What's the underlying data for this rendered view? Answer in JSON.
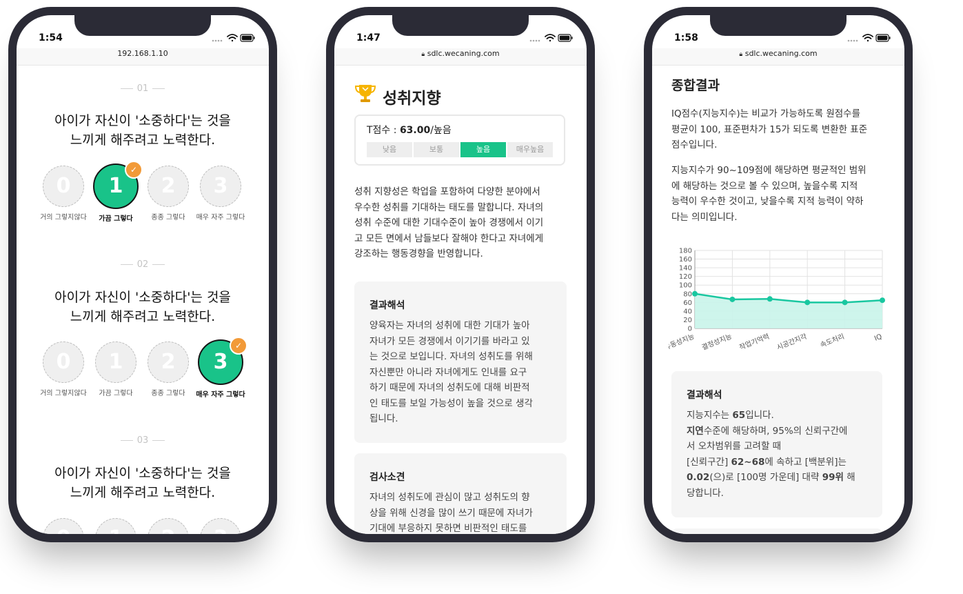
{
  "phones": [
    {
      "status": {
        "time": "1:54"
      },
      "url": "192.168.1.10",
      "questions": [
        {
          "number": "01",
          "text_line1": "아이가 자신이 '소중하다'는 것을",
          "text_line2": "느끼게 해주려고 노력한다.",
          "selected": 1
        },
        {
          "number": "02",
          "text_line1": "아이가 자신이 '소중하다'는 것을",
          "text_line2": "느끼게 해주려고 노력한다.",
          "selected": 3
        },
        {
          "number": "03",
          "text_line1": "아이가 자신이 '소중하다'는 것을",
          "text_line2": "느끼게 해주려고 노력한다.",
          "selected": null
        }
      ],
      "options": [
        {
          "value": "0",
          "label": "거의 그렇지않다"
        },
        {
          "value": "1",
          "label": "가끔 그렇다"
        },
        {
          "value": "2",
          "label": "종종 그렇다"
        },
        {
          "value": "3",
          "label": "매우 자주 그렇다"
        }
      ]
    },
    {
      "status": {
        "time": "1:47"
      },
      "url": "sdlc.wecaning.com",
      "title": "성취지향",
      "t_score_label": "T점수 : ",
      "t_score_value": "63.00",
      "t_score_level": "/높음",
      "levels": [
        "낮음",
        "보통",
        "높음",
        "매우높음"
      ],
      "active_level": "높음",
      "description": [
        "성취 지향성은 학업을 포함하여 다양한 분야에서",
        "우수한 성취를 기대하는 태도를 말합니다. 자녀의",
        "성취 수준에 대한 기대수준이 높아 경쟁에서 이기",
        "고 모든 면에서 남들보다 잘해야 한다고 자녀에게",
        "강조하는 행동경향을 반영합니다."
      ],
      "result": {
        "heading": "결과해석",
        "lines": [
          "양육자는 자녀의 성취에 대한 기대가 높아",
          "자녀가 모든 경쟁에서 이기기를 바라고 있",
          "는 것으로 보입니다. 자녀의 성취도를 위해",
          "자신뿐만 아니라 자녀에게도 인내를 요구",
          "하기 때문에 자녀의 성취도에 대해 비판적",
          "인 태도를 보일 가능성이 높을 것으로 생각",
          "됩니다."
        ]
      },
      "opinion": {
        "heading": "검사소견",
        "lines": [
          "자녀의 성취도에 관심이 많고 성취도의 향",
          "상을 위해 신경을 많이 쓰기 때문에 자녀가",
          "기대에 부응하지 못하면 비판적인 태도를"
        ]
      }
    },
    {
      "status": {
        "time": "1:58"
      },
      "url": "sdlc.wecaning.com",
      "title": "종합결과",
      "para1": [
        "IQ점수(지능지수)는 비교가 가능하도록 원점수를",
        "평균이 100, 표준편차가 15가 되도록 변환한 표준",
        "점수입니다."
      ],
      "para2": [
        "지능지수가 90~109점에 해당하면 평균적인 범위",
        "에 해당하는 것으로 볼 수 있으며, 높을수록 지적",
        "능력이 우수한 것이고, 낮을수록 지적 능력이 약하",
        "다는 의미입니다."
      ],
      "result": {
        "heading": "결과해석",
        "iq_prefix": "지능지수는 ",
        "iq_value": "65",
        "iq_suffix": "입니다.",
        "level_word": "지연",
        "level_rest": "수준에 해당하며, 95%의 신뢰구간에",
        "line3": "서 오차범위를 고려할 때",
        "ci_prefix": "[신뢰구간] ",
        "ci_value": "62~68",
        "ci_suffix": "에 속하고 [백분위]는",
        "pct_value": "0.02",
        "pct_mid": "(으)로 [100명 가운데] 대략 ",
        "rank_value": "99위",
        "pct_suffix": " 해",
        "last": "당합니다."
      }
    }
  ],
  "chart_data": {
    "type": "area",
    "categories": [
      "유동성지능",
      "결정성지능",
      "작업기억력",
      "시공간지각",
      "속도처리",
      "IQ"
    ],
    "values": [
      80,
      67,
      68,
      60,
      60,
      65
    ],
    "ylim": [
      0,
      180
    ],
    "yticks": [
      0,
      20,
      40,
      60,
      80,
      100,
      120,
      140,
      160,
      180
    ],
    "grid": true,
    "colors": {
      "line": "#19c7a0",
      "fill": "#c9f4ea"
    }
  },
  "colors": {
    "accent": "#19c389",
    "check": "#f29a38",
    "frame": "#2b2b36"
  }
}
